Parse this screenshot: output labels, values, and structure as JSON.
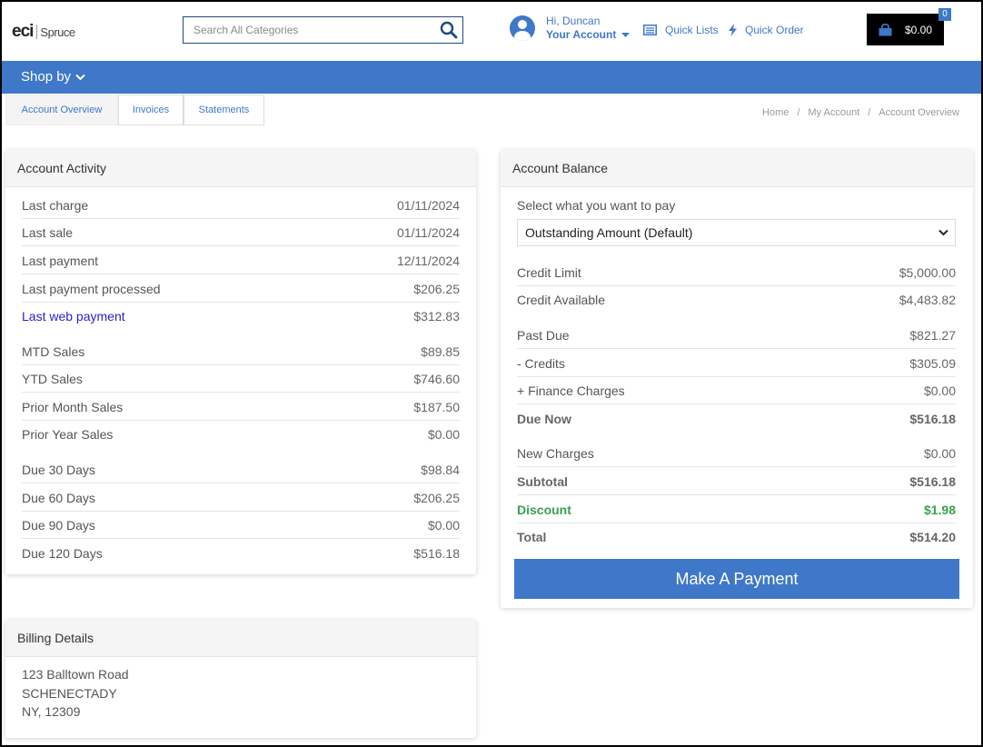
{
  "header": {
    "logo_eci": "eci",
    "logo_spruce": "Spruce",
    "search_placeholder": "Search All Categories",
    "greeting": "Hi, Duncan",
    "your_account": "Your Account",
    "quick_lists": "Quick Lists",
    "quick_order": "Quick Order",
    "cart_total": "$0.00",
    "cart_count": "0"
  },
  "nav": {
    "shop_by": "Shop by"
  },
  "tabs": [
    {
      "label": "Account Overview"
    },
    {
      "label": "Invoices"
    },
    {
      "label": "Statements"
    }
  ],
  "breadcrumb": [
    {
      "label": "Home"
    },
    {
      "label": "My Account"
    },
    {
      "label": "Account Overview"
    }
  ],
  "activity": {
    "title": "Account Activity",
    "rows": [
      {
        "label": "Last charge",
        "value": "01/11/2024"
      },
      {
        "label": "Last sale",
        "value": "01/11/2024"
      },
      {
        "label": "Last payment",
        "value": "12/11/2024"
      },
      {
        "label": "Last payment processed",
        "value": "$206.25"
      },
      {
        "label": "Last web payment",
        "value": "$312.83"
      },
      {
        "label": "MTD Sales",
        "value": "$89.85"
      },
      {
        "label": "YTD Sales",
        "value": "$746.60"
      },
      {
        "label": "Prior Month Sales",
        "value": "$187.50"
      },
      {
        "label": "Prior Year Sales",
        "value": "$0.00"
      },
      {
        "label": "Due 30 Days",
        "value": "$98.84"
      },
      {
        "label": "Due 60 Days",
        "value": "$206.25"
      },
      {
        "label": "Due 90 Days",
        "value": "$0.00"
      },
      {
        "label": "Due 120 Days",
        "value": "$516.18"
      }
    ]
  },
  "balance": {
    "title": "Account Balance",
    "select_label": "Select what you want to pay",
    "select_value": "Outstanding Amount (Default)",
    "rows": [
      {
        "label": "Credit Limit",
        "value": "$5,000.00"
      },
      {
        "label": "Credit Available",
        "value": "$4,483.82"
      },
      {
        "label": "Past Due",
        "value": "$821.27"
      },
      {
        "label": "- Credits",
        "value": "$305.09"
      },
      {
        "label": "+ Finance Charges",
        "value": "$0.00"
      },
      {
        "label": "Due Now",
        "value": "$516.18"
      },
      {
        "label": "New Charges",
        "value": "$0.00"
      },
      {
        "label": "Subtotal",
        "value": "$516.18"
      },
      {
        "label": "Discount",
        "value": "$1.98"
      },
      {
        "label": "Total",
        "value": "$514.20"
      }
    ],
    "pay_button": "Make A Payment"
  },
  "billing": {
    "title": "Billing Details",
    "address_line1": "123 Balltown Road",
    "address_line2": "SCHENECTADY",
    "address_line3": "NY, 12309"
  },
  "colors": {
    "brand_blue": "#3f78c9",
    "discount_green": "#3aa14d",
    "link_purple": "#2a1fc9"
  }
}
